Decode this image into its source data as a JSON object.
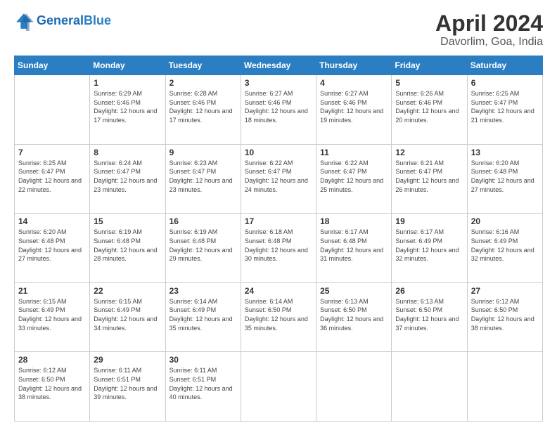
{
  "header": {
    "logo_text_general": "General",
    "logo_text_blue": "Blue",
    "title": "April 2024",
    "subtitle": "Davorlim, Goa, India"
  },
  "columns": [
    "Sunday",
    "Monday",
    "Tuesday",
    "Wednesday",
    "Thursday",
    "Friday",
    "Saturday"
  ],
  "weeks": [
    [
      {
        "day": "",
        "sunrise": "",
        "sunset": "",
        "daylight": ""
      },
      {
        "day": "1",
        "sunrise": "Sunrise: 6:29 AM",
        "sunset": "Sunset: 6:46 PM",
        "daylight": "Daylight: 12 hours and 17 minutes."
      },
      {
        "day": "2",
        "sunrise": "Sunrise: 6:28 AM",
        "sunset": "Sunset: 6:46 PM",
        "daylight": "Daylight: 12 hours and 17 minutes."
      },
      {
        "day": "3",
        "sunrise": "Sunrise: 6:27 AM",
        "sunset": "Sunset: 6:46 PM",
        "daylight": "Daylight: 12 hours and 18 minutes."
      },
      {
        "day": "4",
        "sunrise": "Sunrise: 6:27 AM",
        "sunset": "Sunset: 6:46 PM",
        "daylight": "Daylight: 12 hours and 19 minutes."
      },
      {
        "day": "5",
        "sunrise": "Sunrise: 6:26 AM",
        "sunset": "Sunset: 6:46 PM",
        "daylight": "Daylight: 12 hours and 20 minutes."
      },
      {
        "day": "6",
        "sunrise": "Sunrise: 6:25 AM",
        "sunset": "Sunset: 6:47 PM",
        "daylight": "Daylight: 12 hours and 21 minutes."
      }
    ],
    [
      {
        "day": "7",
        "sunrise": "Sunrise: 6:25 AM",
        "sunset": "Sunset: 6:47 PM",
        "daylight": "Daylight: 12 hours and 22 minutes."
      },
      {
        "day": "8",
        "sunrise": "Sunrise: 6:24 AM",
        "sunset": "Sunset: 6:47 PM",
        "daylight": "Daylight: 12 hours and 23 minutes."
      },
      {
        "day": "9",
        "sunrise": "Sunrise: 6:23 AM",
        "sunset": "Sunset: 6:47 PM",
        "daylight": "Daylight: 12 hours and 23 minutes."
      },
      {
        "day": "10",
        "sunrise": "Sunrise: 6:22 AM",
        "sunset": "Sunset: 6:47 PM",
        "daylight": "Daylight: 12 hours and 24 minutes."
      },
      {
        "day": "11",
        "sunrise": "Sunrise: 6:22 AM",
        "sunset": "Sunset: 6:47 PM",
        "daylight": "Daylight: 12 hours and 25 minutes."
      },
      {
        "day": "12",
        "sunrise": "Sunrise: 6:21 AM",
        "sunset": "Sunset: 6:47 PM",
        "daylight": "Daylight: 12 hours and 26 minutes."
      },
      {
        "day": "13",
        "sunrise": "Sunrise: 6:20 AM",
        "sunset": "Sunset: 6:48 PM",
        "daylight": "Daylight: 12 hours and 27 minutes."
      }
    ],
    [
      {
        "day": "14",
        "sunrise": "Sunrise: 6:20 AM",
        "sunset": "Sunset: 6:48 PM",
        "daylight": "Daylight: 12 hours and 27 minutes."
      },
      {
        "day": "15",
        "sunrise": "Sunrise: 6:19 AM",
        "sunset": "Sunset: 6:48 PM",
        "daylight": "Daylight: 12 hours and 28 minutes."
      },
      {
        "day": "16",
        "sunrise": "Sunrise: 6:19 AM",
        "sunset": "Sunset: 6:48 PM",
        "daylight": "Daylight: 12 hours and 29 minutes."
      },
      {
        "day": "17",
        "sunrise": "Sunrise: 6:18 AM",
        "sunset": "Sunset: 6:48 PM",
        "daylight": "Daylight: 12 hours and 30 minutes."
      },
      {
        "day": "18",
        "sunrise": "Sunrise: 6:17 AM",
        "sunset": "Sunset: 6:48 PM",
        "daylight": "Daylight: 12 hours and 31 minutes."
      },
      {
        "day": "19",
        "sunrise": "Sunrise: 6:17 AM",
        "sunset": "Sunset: 6:49 PM",
        "daylight": "Daylight: 12 hours and 32 minutes."
      },
      {
        "day": "20",
        "sunrise": "Sunrise: 6:16 AM",
        "sunset": "Sunset: 6:49 PM",
        "daylight": "Daylight: 12 hours and 32 minutes."
      }
    ],
    [
      {
        "day": "21",
        "sunrise": "Sunrise: 6:15 AM",
        "sunset": "Sunset: 6:49 PM",
        "daylight": "Daylight: 12 hours and 33 minutes."
      },
      {
        "day": "22",
        "sunrise": "Sunrise: 6:15 AM",
        "sunset": "Sunset: 6:49 PM",
        "daylight": "Daylight: 12 hours and 34 minutes."
      },
      {
        "day": "23",
        "sunrise": "Sunrise: 6:14 AM",
        "sunset": "Sunset: 6:49 PM",
        "daylight": "Daylight: 12 hours and 35 minutes."
      },
      {
        "day": "24",
        "sunrise": "Sunrise: 6:14 AM",
        "sunset": "Sunset: 6:50 PM",
        "daylight": "Daylight: 12 hours and 35 minutes."
      },
      {
        "day": "25",
        "sunrise": "Sunrise: 6:13 AM",
        "sunset": "Sunset: 6:50 PM",
        "daylight": "Daylight: 12 hours and 36 minutes."
      },
      {
        "day": "26",
        "sunrise": "Sunrise: 6:13 AM",
        "sunset": "Sunset: 6:50 PM",
        "daylight": "Daylight: 12 hours and 37 minutes."
      },
      {
        "day": "27",
        "sunrise": "Sunrise: 6:12 AM",
        "sunset": "Sunset: 6:50 PM",
        "daylight": "Daylight: 12 hours and 38 minutes."
      }
    ],
    [
      {
        "day": "28",
        "sunrise": "Sunrise: 6:12 AM",
        "sunset": "Sunset: 6:50 PM",
        "daylight": "Daylight: 12 hours and 38 minutes."
      },
      {
        "day": "29",
        "sunrise": "Sunrise: 6:11 AM",
        "sunset": "Sunset: 6:51 PM",
        "daylight": "Daylight: 12 hours and 39 minutes."
      },
      {
        "day": "30",
        "sunrise": "Sunrise: 6:11 AM",
        "sunset": "Sunset: 6:51 PM",
        "daylight": "Daylight: 12 hours and 40 minutes."
      },
      {
        "day": "",
        "sunrise": "",
        "sunset": "",
        "daylight": ""
      },
      {
        "day": "",
        "sunrise": "",
        "sunset": "",
        "daylight": ""
      },
      {
        "day": "",
        "sunrise": "",
        "sunset": "",
        "daylight": ""
      },
      {
        "day": "",
        "sunrise": "",
        "sunset": "",
        "daylight": ""
      }
    ]
  ]
}
